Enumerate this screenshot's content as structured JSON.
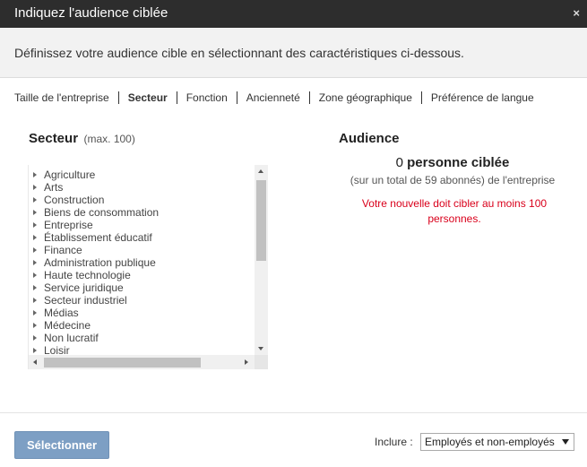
{
  "dialog": {
    "title": "Indiquez l'audience ciblée",
    "close_glyph": "×",
    "intro": "Définissez votre audience cible en sélectionnant des caractéristiques ci-dessous."
  },
  "tabs": [
    {
      "label": "Taille de l'entreprise",
      "active": false
    },
    {
      "label": "Secteur",
      "active": true
    },
    {
      "label": "Fonction",
      "active": false
    },
    {
      "label": "Ancienneté",
      "active": false
    },
    {
      "label": "Zone géographique",
      "active": false
    },
    {
      "label": "Préférence de langue",
      "active": false
    }
  ],
  "sector": {
    "heading": "Secteur",
    "limit": "(max. 100)",
    "items": [
      "Agriculture",
      "Arts",
      "Construction",
      "Biens de consommation",
      "Entreprise",
      "Établissement éducatif",
      "Finance",
      "Administration publique",
      "Haute technologie",
      "Service juridique",
      "Secteur industriel",
      "Médias",
      "Médecine",
      "Non lucratif",
      "Loisir"
    ]
  },
  "audience": {
    "heading": "Audience",
    "count": "0",
    "count_label": "personne ciblée",
    "total": "(sur un total de 59 abonnés) de l'entreprise",
    "warning": "Votre nouvelle doit cibler au moins 100 personnes.",
    "warning_color": "#d9001b"
  },
  "footer": {
    "select_button": "Sélectionner",
    "include_label": "Inclure :",
    "include_value": "Employés et non-employés"
  },
  "colors": {
    "titlebar": "#2d2d2d",
    "button": "#7d9fc4"
  },
  "icons": {
    "close": "close-icon",
    "tree_item": "chevron-right-icon",
    "dropdown": "caret-down-icon"
  }
}
